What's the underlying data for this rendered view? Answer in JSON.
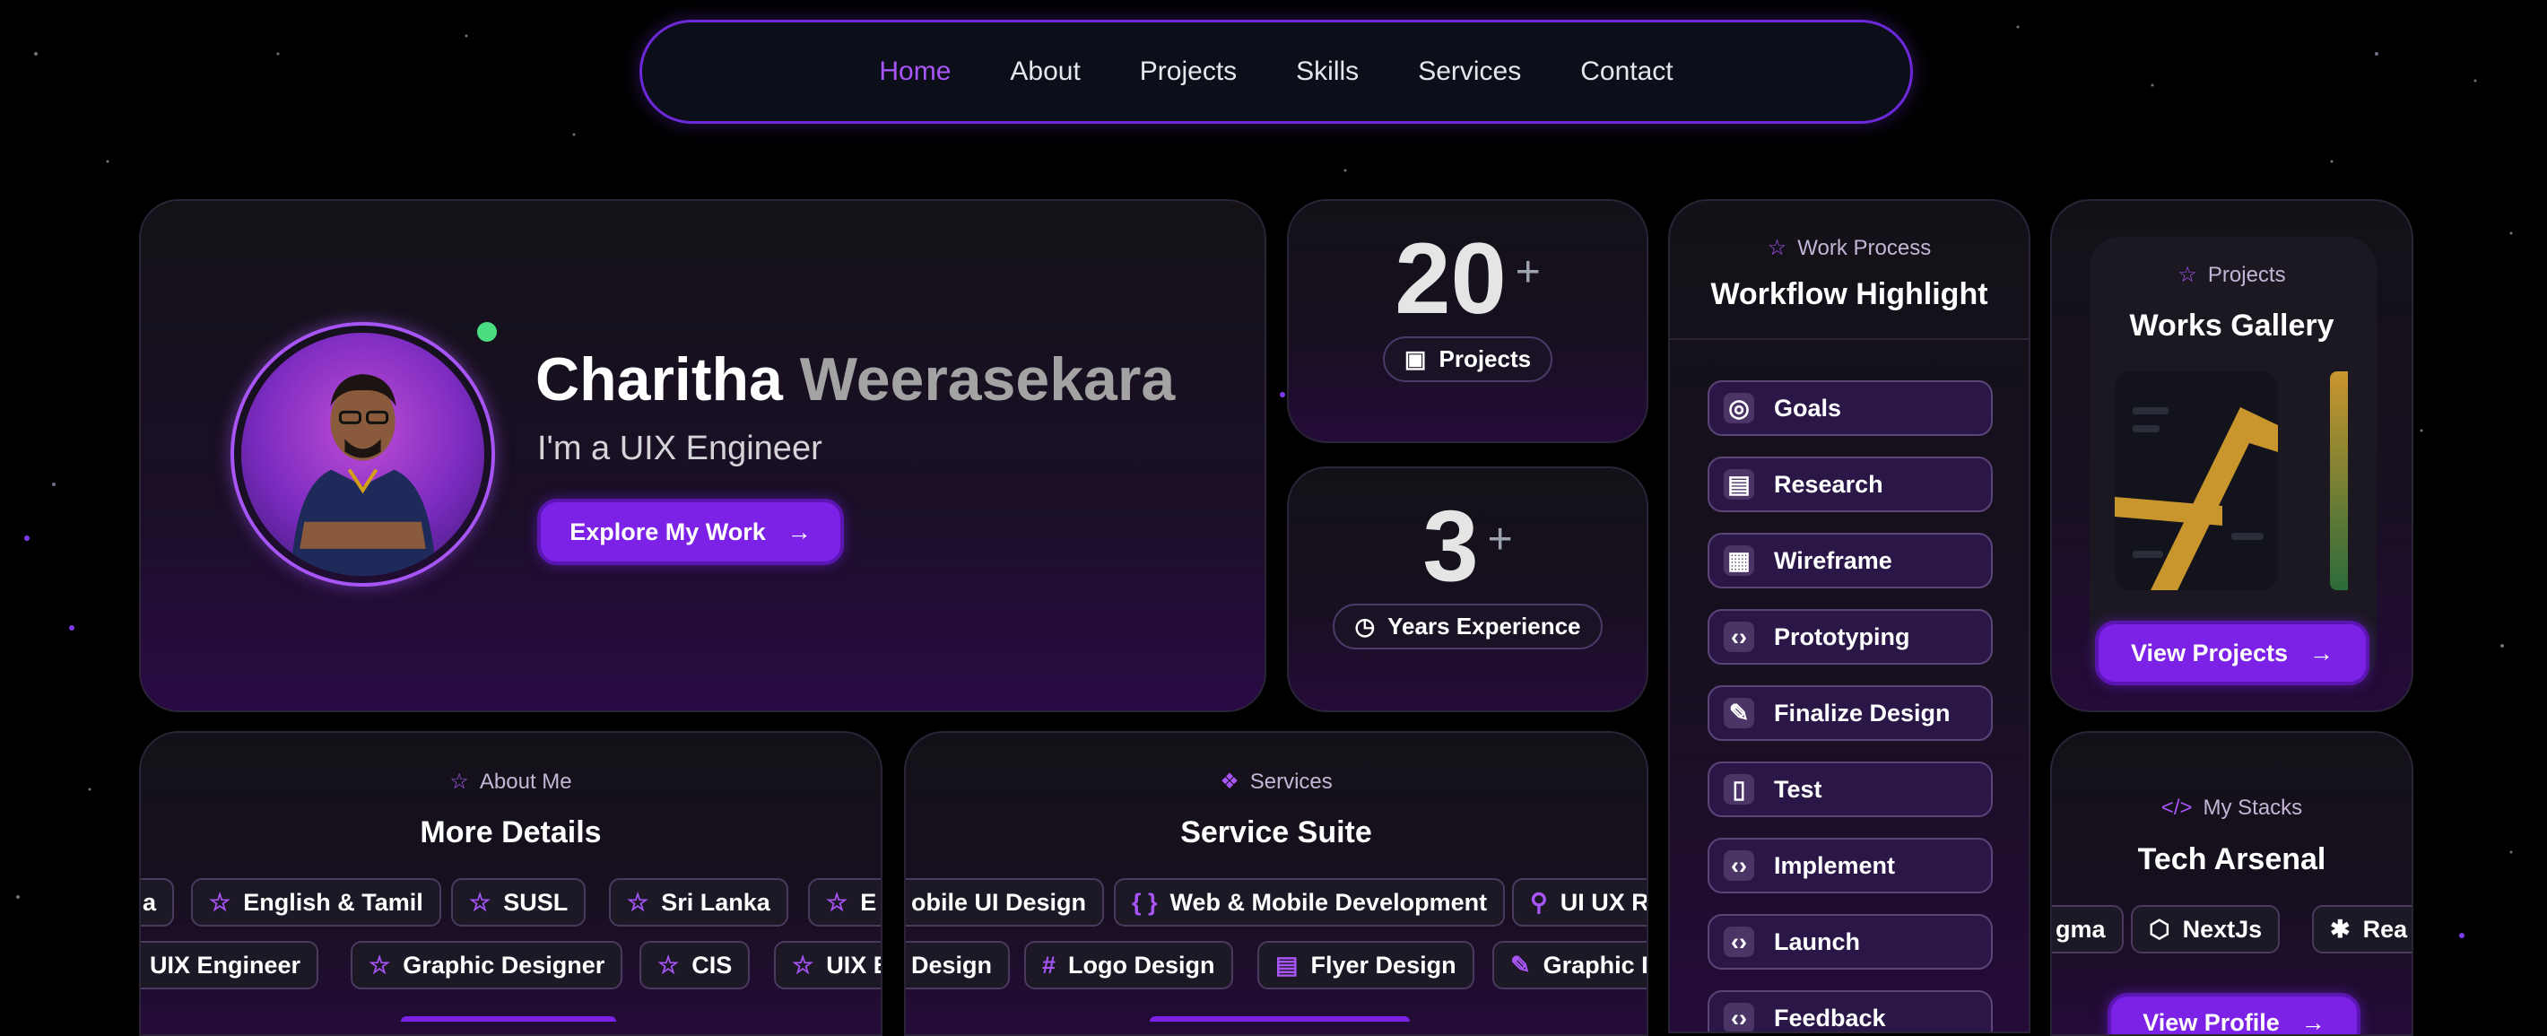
{
  "nav": {
    "items": [
      "Home",
      "About",
      "Projects",
      "Skills",
      "Services",
      "Contact"
    ],
    "active": "Home"
  },
  "hero": {
    "first_name": "Charitha",
    "last_name": "Weerasekara",
    "role": "I'm a UIX Engineer",
    "cta": "Explore My Work"
  },
  "stats": {
    "projects": {
      "value": "20",
      "plus": "+",
      "label": "Projects"
    },
    "experience": {
      "value": "3",
      "plus": "+",
      "label": "Years Experience"
    }
  },
  "workflow": {
    "eyebrow": "Work Process",
    "title": "Workflow Highlight",
    "steps": [
      "Goals",
      "Research",
      "Wireframe",
      "Prototyping",
      "Finalize Design",
      "Test",
      "Implement",
      "Launch",
      "Feedback"
    ]
  },
  "gallery": {
    "eyebrow": "Projects",
    "title": "Works Gallery",
    "button": "View Projects"
  },
  "about": {
    "eyebrow": "About Me",
    "title": "More Details",
    "row1": [
      "a",
      "English & Tamil",
      "SUSL",
      "Sri Lanka",
      "E"
    ],
    "row2": [
      "UIX Engineer",
      "Graphic Designer",
      "CIS",
      "UIX E"
    ]
  },
  "services": {
    "eyebrow": "Services",
    "title": "Service Suite",
    "row1": [
      "obile UI Design",
      "Web & Mobile Development",
      "UI UX R"
    ],
    "row2": [
      "Design",
      "Logo Design",
      "Flyer Design",
      "Graphic D"
    ]
  },
  "stacks": {
    "eyebrow": "My Stacks",
    "title": "Tech Arsenal",
    "items": [
      "gma",
      "NextJs",
      "Rea"
    ],
    "button": "View Profile"
  },
  "colors": {
    "accent": "#7c22e6",
    "accent_light": "#a855f7",
    "online": "#4ade80"
  }
}
